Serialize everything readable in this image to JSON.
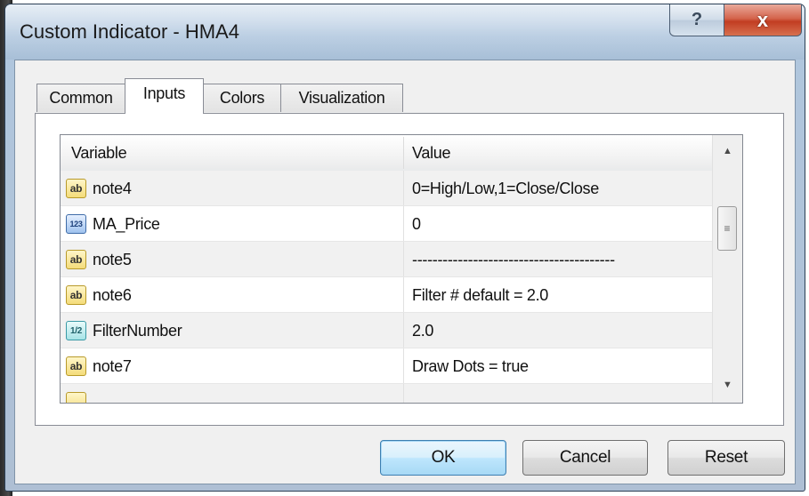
{
  "window": {
    "title": "Custom Indicator - HMA4"
  },
  "caption_buttons": {
    "help": "?",
    "close": "x"
  },
  "tabs": [
    {
      "label": "Common",
      "active": false
    },
    {
      "label": "Inputs",
      "active": true
    },
    {
      "label": "Colors",
      "active": false
    },
    {
      "label": "Visualization",
      "active": false
    }
  ],
  "table": {
    "columns": [
      "Variable",
      "Value"
    ],
    "rows": [
      {
        "icon": "ab",
        "variable": "note4",
        "value": "0=High/Low,1=Close/Close"
      },
      {
        "icon": "123",
        "variable": "MA_Price",
        "value": "0"
      },
      {
        "icon": "ab",
        "variable": "note5",
        "value": "----------------------------------------"
      },
      {
        "icon": "ab",
        "variable": "note6",
        "value": "Filter # default = 2.0"
      },
      {
        "icon": "1/2",
        "variable": "FilterNumber",
        "value": "2.0"
      },
      {
        "icon": "ab",
        "variable": "note7",
        "value": "Draw Dots = true"
      }
    ]
  },
  "scrollbar": {
    "up": "▲",
    "down": "▼",
    "grip": "≡"
  },
  "buttons": {
    "ok": "OK",
    "cancel": "Cancel",
    "reset": "Reset"
  }
}
